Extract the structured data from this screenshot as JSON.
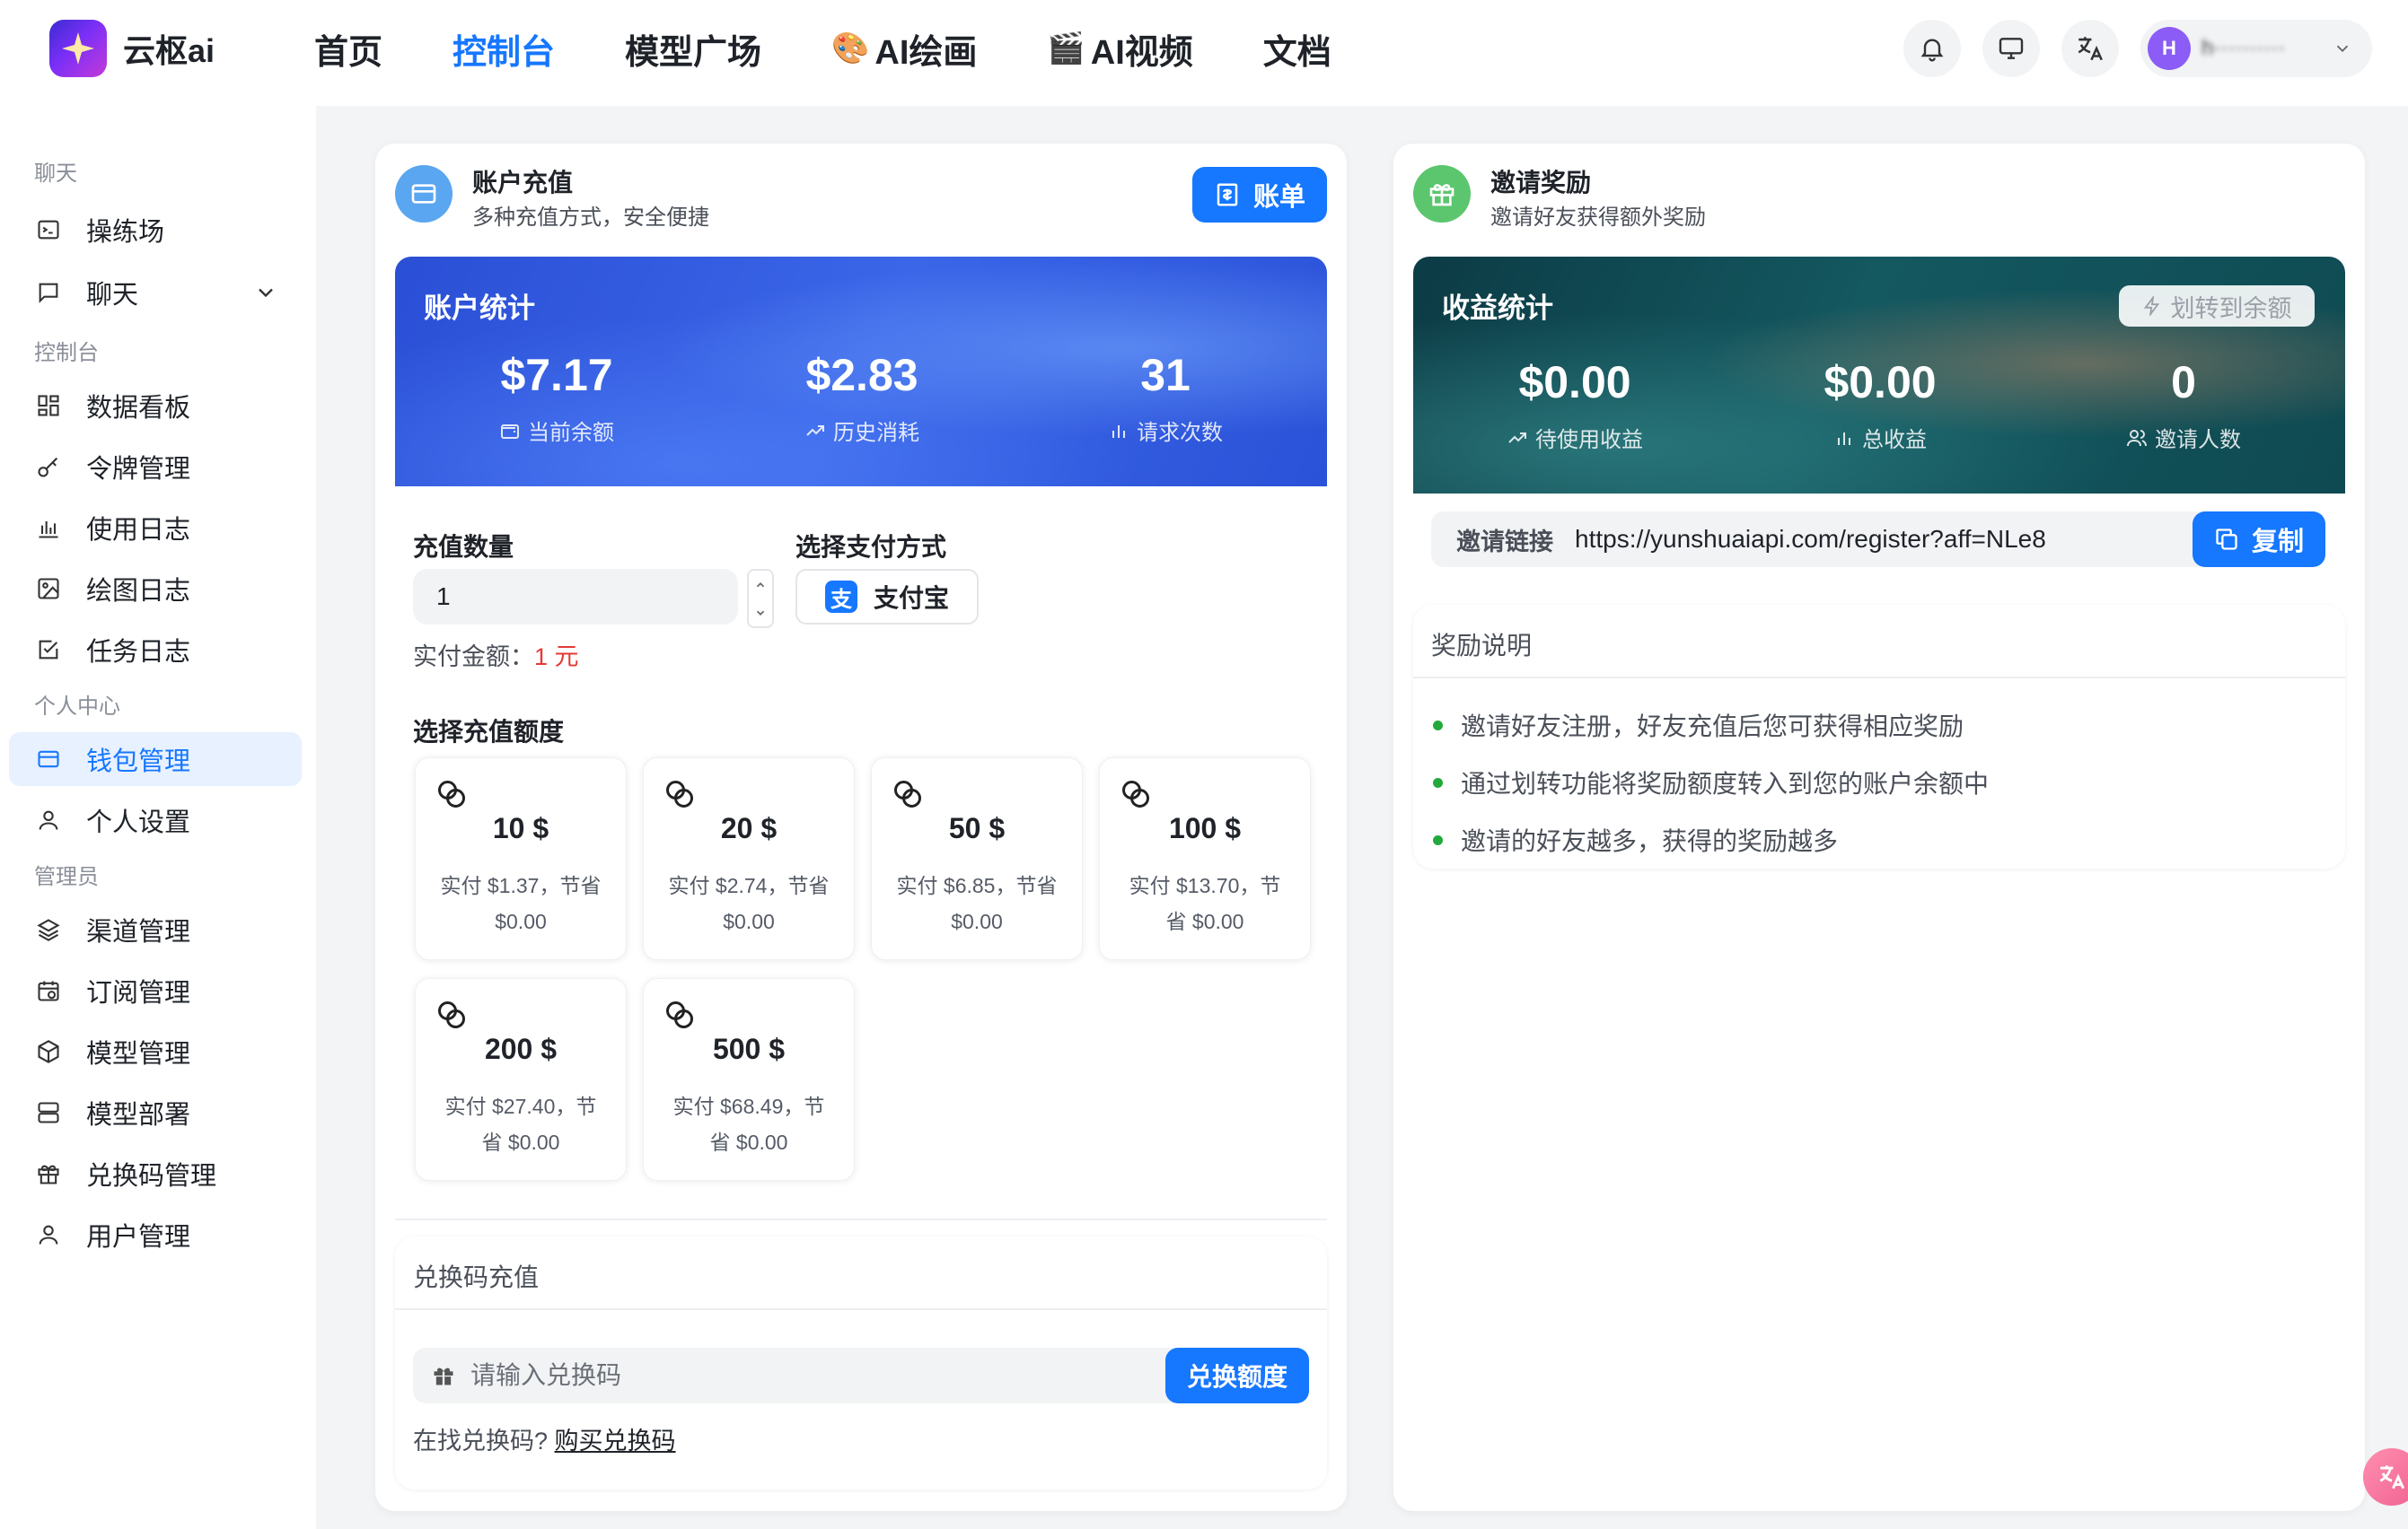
{
  "app": {
    "logo_text": "云枢ai",
    "floating_icon": "translate-icon"
  },
  "nav": {
    "home": "首页",
    "console": "控制台",
    "models": "模型广场",
    "ai_paint": "AI绘画",
    "ai_video": "AI视频",
    "docs": "文档"
  },
  "header": {
    "user_initial": "H",
    "user_name": "h··········"
  },
  "sidebar": {
    "group_chat": "聊天",
    "playground": "操练场",
    "chat": "聊天",
    "group_console": "控制台",
    "dashboard": "数据看板",
    "tokens": "令牌管理",
    "usage_log": "使用日志",
    "draw_log": "绘图日志",
    "task_log": "任务日志",
    "group_personal": "个人中心",
    "wallet": "钱包管理",
    "settings": "个人设置",
    "group_admin": "管理员",
    "channels": "渠道管理",
    "subscriptions": "订阅管理",
    "model_mgmt": "模型管理",
    "deploy": "模型部署",
    "redeem_mgmt": "兑换码管理",
    "users": "用户管理"
  },
  "recharge": {
    "title": "账户充值",
    "subtitle": "多种充值方式，安全便捷",
    "bill_button": "账单",
    "stats_title": "账户统计",
    "balance": "$7.17",
    "balance_label": "当前余额",
    "consumed": "$2.83",
    "consumed_label": "历史消耗",
    "requests": "31",
    "requests_label": "请求次数",
    "quantity_label": "充值数量",
    "quantity_value": "1",
    "pay_method_label": "选择支付方式",
    "alipay": "支付宝",
    "pay_amount_prefix": "实付金额：",
    "pay_amount_value": "1 元",
    "amount_section": "选择充值额度",
    "amounts": [
      {
        "amount": "10 $",
        "desc": "实付 $1.37，节省 $0.00"
      },
      {
        "amount": "20 $",
        "desc": "实付 $2.74，节省 $0.00"
      },
      {
        "amount": "50 $",
        "desc": "实付 $6.85，节省 $0.00"
      },
      {
        "amount": "100 $",
        "desc": "实付 $13.70，节省 $0.00"
      },
      {
        "amount": "200 $",
        "desc": "实付 $27.40，节省 $0.00"
      },
      {
        "amount": "500 $",
        "desc": "实付 $68.49，节省 $0.00"
      }
    ]
  },
  "redeem": {
    "title": "兑换码充值",
    "placeholder": "请输入兑换码",
    "button": "兑换额度",
    "hint_prefix": "在找兑换码?",
    "hint_link": "购买兑换码"
  },
  "invite": {
    "title": "邀请奖励",
    "subtitle": "邀请好友获得额外奖励",
    "stats_title": "收益统计",
    "transfer_button": "划转到余额",
    "pending": "$0.00",
    "pending_label": "待使用收益",
    "total": "$0.00",
    "total_label": "总收益",
    "invitees": "0",
    "invitees_label": "邀请人数",
    "link_label": "邀请链接",
    "link_url": "https://yunshuaiapi.com/register?aff=NLe8",
    "copy_button": "复制",
    "rules_title": "奖励说明",
    "rules": [
      "邀请好友注册，好友充值后您可获得相应奖励",
      "通过划转功能将奖励额度转入到您的账户余额中",
      "邀请的好友越多，获得的奖励越多"
    ]
  },
  "colors": {
    "primary": "#1677ff",
    "stats_blue": "#2f5fe0",
    "stats_teal": "#0f4c53",
    "success_dot": "#22a93b"
  }
}
